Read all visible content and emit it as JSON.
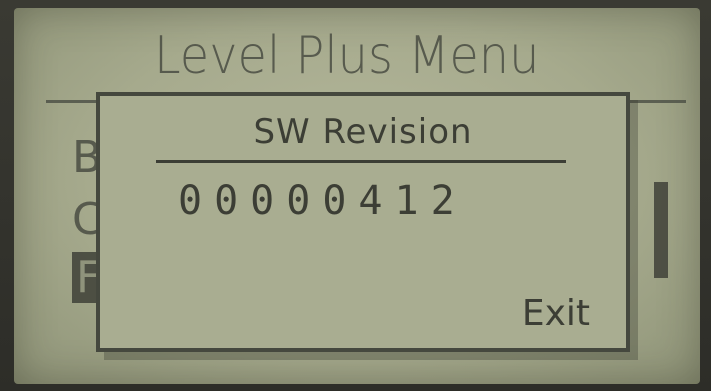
{
  "background_menu": {
    "title": "Level Plus Menu",
    "items": [
      {
        "label": "B"
      },
      {
        "label": "C"
      },
      {
        "label": "F"
      }
    ]
  },
  "dialog": {
    "title": "SW Revision",
    "value": "00000412",
    "exit_label": "Exit"
  },
  "colors": {
    "lcd_background": "#a9ad91",
    "lcd_text": "#3c3e35"
  }
}
